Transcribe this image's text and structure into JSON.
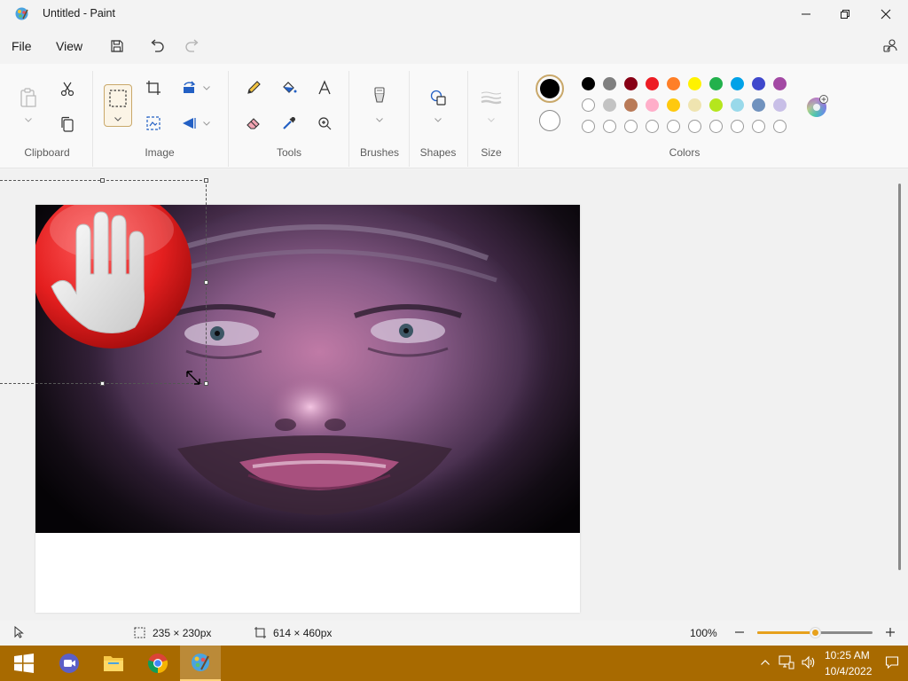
{
  "window": {
    "title": "Untitled - Paint"
  },
  "menu": {
    "file": "File",
    "view": "View"
  },
  "ribbon": {
    "groups": {
      "clipboard": "Clipboard",
      "image": "Image",
      "tools": "Tools",
      "brushes": "Brushes",
      "shapes": "Shapes",
      "size": "Size",
      "colors": "Colors"
    },
    "primary_color": "#000000",
    "secondary_color": "#ffffff",
    "palette_row1": [
      "#000000",
      "#7f7f7f",
      "#880015",
      "#ed1c24",
      "#ff7f27",
      "#fff200",
      "#22b14c",
      "#00a2e8",
      "#3f48cc",
      "#a349a4"
    ],
    "palette_row2": [
      "#ffffff",
      "#c3c3c3",
      "#b97a57",
      "#ffaec9",
      "#ffc90e",
      "#efe4b0",
      "#b5e61d",
      "#99d9ea",
      "#7092be",
      "#c8bfe7"
    ]
  },
  "status": {
    "selection_size": "235 × 230px",
    "canvas_size": "614 × 460px",
    "zoom": "100%",
    "zoom_level_fraction": 0.5
  },
  "taskbar": {
    "time": "10:25 AM",
    "date": "10/4/2022",
    "color": "#a86a00"
  }
}
